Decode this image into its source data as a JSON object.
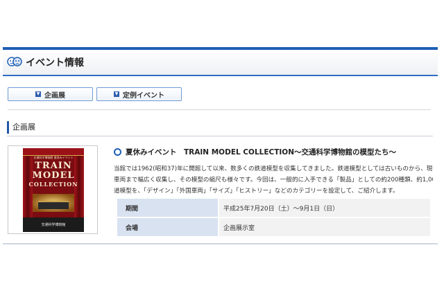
{
  "header": {
    "title": "イベント情報",
    "icon": "masks-icon"
  },
  "tabs": [
    {
      "label": "企画展",
      "icon": "arrow-down-icon"
    },
    {
      "label": "定例イベント",
      "icon": "arrow-down-icon"
    }
  ],
  "section": {
    "title": "企画展"
  },
  "event": {
    "title": "夏休みイベント　TRAIN MODEL COLLECTION～交通科学博物館の模型たち～",
    "description_lines": [
      "当館では1962(昭和37)年に開館して以来、数多くの鉄道模型を収集してきました。鉄道模型としては古いものから、現在の新型",
      "車両まで幅広く収集し、その模型の縮尺も様々です。今回は、一般的に入手できる「製品」としての約200種類、約1,000両の鉄",
      "道模型を、「デザイン」「外国車両」「サイズ」「ヒストリー」などのカテゴリーを設定して、ご紹介します。"
    ],
    "info": [
      {
        "label": "期間",
        "value": "平成25年7月20日（土）～9月1日（日）"
      },
      {
        "label": "会場",
        "value": "企画展示室"
      }
    ],
    "poster": {
      "subtitle": "交通科学博物館 夏休みイベント",
      "title_line1": "TRAIN",
      "title_line2": "MODEL",
      "title_line3": "COLLECTION",
      "footer": "交通科学博物館"
    }
  },
  "colors": {
    "accent": "#1f5fb5",
    "table_header_bg": "#d8e2f1",
    "table_cell_bg": "#f2f2f2"
  }
}
